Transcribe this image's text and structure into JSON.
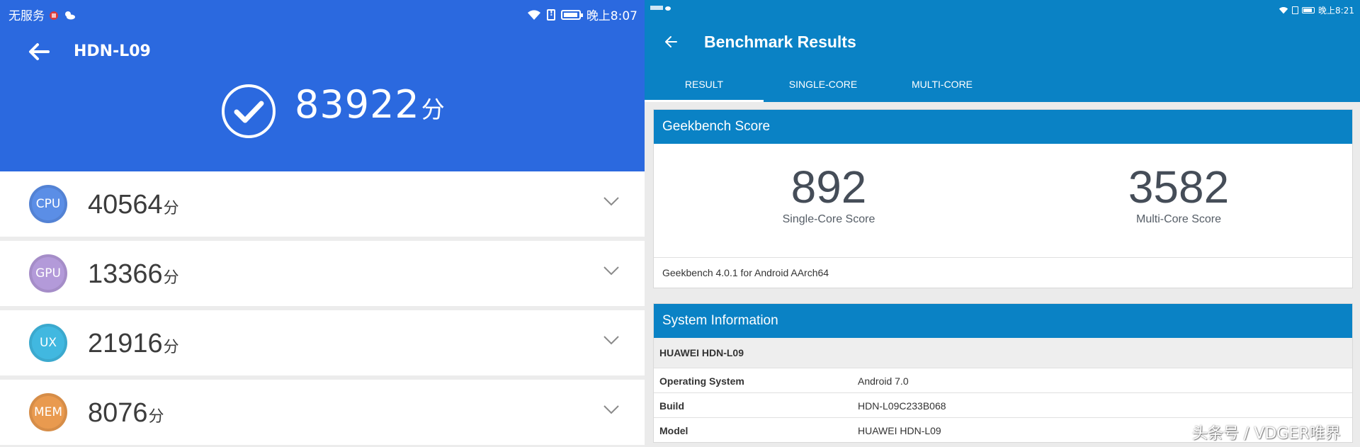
{
  "antutu": {
    "status": {
      "carrier": "无服务",
      "time": "晚上8:07"
    },
    "device_title": "HDN-L09",
    "total_score": "83922",
    "unit": "分",
    "rows": [
      {
        "label": "CPU",
        "score": "40564",
        "color": "#5b8ee6"
      },
      {
        "label": "GPU",
        "score": "13366",
        "color": "#b39ad9"
      },
      {
        "label": "UX",
        "score": "21916",
        "color": "#41b8e0"
      },
      {
        "label": "MEM",
        "score": "8076",
        "color": "#e99a4f"
      }
    ],
    "colors": {
      "header": "#2b69df"
    }
  },
  "geekbench": {
    "status": {
      "time": "晚上8:21"
    },
    "title": "Benchmark Results",
    "tabs": [
      "RESULT",
      "SINGLE-CORE",
      "MULTI-CORE"
    ],
    "active_tab": "RESULT",
    "score_card": {
      "heading": "Geekbench Score",
      "single_value": "892",
      "single_label": "Single-Core Score",
      "multi_value": "3582",
      "multi_label": "Multi-Core Score",
      "version": "Geekbench 4.0.1 for Android AArch64"
    },
    "system_card": {
      "heading": "System Information",
      "device": "HUAWEI HDN-L09",
      "rows": [
        {
          "key": "Operating System",
          "value": "Android 7.0"
        },
        {
          "key": "Build",
          "value": "HDN-L09C233B068"
        },
        {
          "key": "Model",
          "value": "HUAWEI HDN-L09"
        }
      ]
    },
    "colors": {
      "primary": "#0a82c5"
    }
  },
  "watermark": "头条号 / VDGER唯界"
}
